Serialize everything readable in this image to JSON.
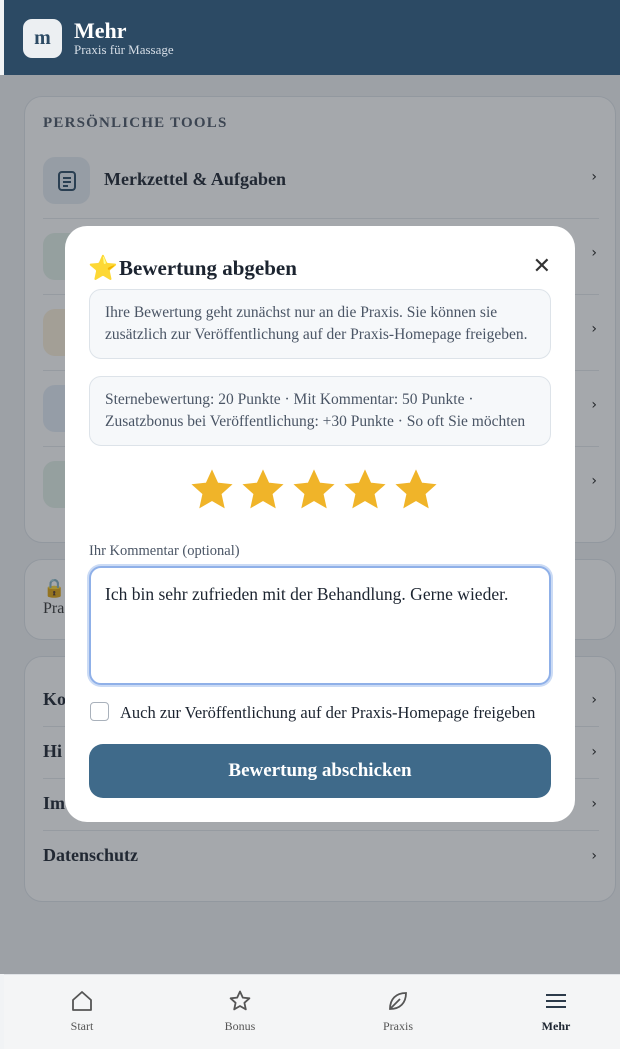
{
  "header": {
    "logo_letter": "m",
    "title": "Mehr",
    "subtitle": "Praxis für Massage"
  },
  "tools_section": {
    "title": "PERSÖNLICHE TOOLS",
    "items": [
      {
        "label": "Merkzettel & Aufgaben",
        "icon": "notepad-icon"
      }
    ]
  },
  "privacy_card": {
    "label": "Pra"
  },
  "links": [
    "Ko",
    "Hi",
    "Im",
    "Datenschutz"
  ],
  "modal": {
    "title_icon": "⭐",
    "title": "Bewertung abgeben",
    "close_glyph": "✕",
    "info1": "Ihre Bewertung geht zunächst nur an die Praxis. Sie können sie zusätzlich zur Veröffentlichung auf der Praxis-Homepage freigeben.",
    "info2": "Sternebewertung: 20 Punkte · Mit Kommentar: 50 Punkte · Zusatzbonus bei Veröffentlichung: +30 Punkte · So oft Sie möchten",
    "rating": 5,
    "rating_max": 5,
    "star_color": "#f0b429",
    "comment_label": "Ihr Kommentar (optional)",
    "comment_value": "Ich bin sehr zufrieden mit der Behandlung. Gerne wieder.",
    "publish_label": "Auch zur Veröffentlichung auf der Praxis-Homepage freigeben",
    "publish_checked": false,
    "submit_label": "Bewertung abschicken",
    "submit_color": "#3f6a8a"
  },
  "bottom_nav": [
    {
      "label": "Start",
      "icon": "home-icon"
    },
    {
      "label": "Bonus",
      "icon": "star-icon"
    },
    {
      "label": "Praxis",
      "icon": "leaf-icon"
    },
    {
      "label": "Mehr",
      "icon": "menu-icon",
      "active": true
    }
  ]
}
